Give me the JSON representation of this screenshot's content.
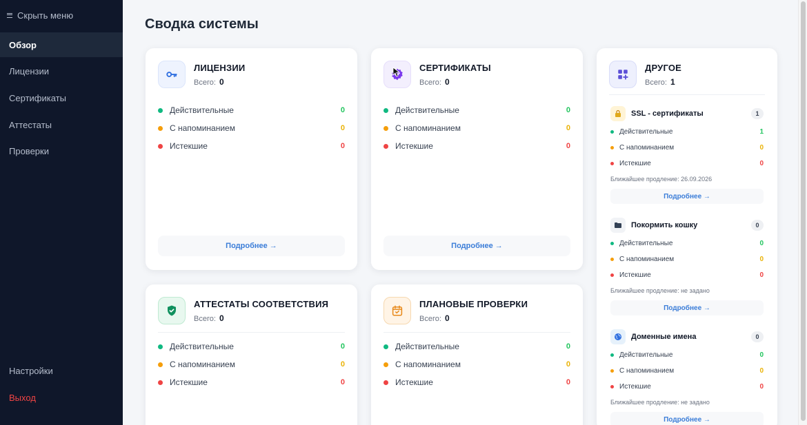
{
  "sidebar": {
    "collapse_label": "Скрыть меню",
    "items": [
      {
        "label": "Обзор"
      },
      {
        "label": "Лицензии"
      },
      {
        "label": "Сертификаты"
      },
      {
        "label": "Аттестаты"
      },
      {
        "label": "Проверки"
      }
    ],
    "settings": "Настройки",
    "logout": "Выход"
  },
  "page_title": "Сводка системы",
  "common": {
    "total_label": "Всего:",
    "valid": "Действительные",
    "reminder": "С напоминанием",
    "expired": "Истекшие",
    "more": "Подробнее →"
  },
  "cards": {
    "licenses": {
      "title": "ЛИЦЕНЗИИ",
      "total": "0",
      "valid": "0",
      "reminder": "0",
      "expired": "0",
      "icon": "key-icon"
    },
    "certificates": {
      "title": "СЕРТИФИКАТЫ",
      "total": "0",
      "valid": "0",
      "reminder": "0",
      "expired": "0",
      "icon": "verified-badge-icon"
    },
    "other": {
      "title": "ДРУГОЕ",
      "total": "1",
      "icon": "grid-plus-icon"
    },
    "attestations": {
      "title": "АТТЕСТАТЫ СООТВЕТСТВИЯ",
      "total": "0",
      "valid": "0",
      "reminder": "0",
      "expired": "0",
      "icon": "shield-check-icon"
    },
    "inspections": {
      "title": "ПЛАНОВЫЕ ПРОВЕРКИ",
      "total": "0",
      "valid": "0",
      "reminder": "0",
      "expired": "0",
      "icon": "calendar-check-icon"
    }
  },
  "other_sections": {
    "ssl": {
      "title": "SSL - сертификаты",
      "count": "1",
      "valid": "1",
      "reminder": "0",
      "expired": "0",
      "renewal": "Ближайшее продление: 26.09.2026",
      "icon": "lock-icon"
    },
    "cat": {
      "title": "Покормить кошку",
      "count": "0",
      "valid": "0",
      "reminder": "0",
      "expired": "0",
      "renewal": "Ближайшее продление: не задано",
      "icon": "folder-icon"
    },
    "domains": {
      "title": "Доменные имена",
      "count": "0",
      "valid": "0",
      "reminder": "0",
      "expired": "0",
      "renewal": "Ближайшее продление: не задано",
      "icon": "globe-icon"
    }
  },
  "colors": {
    "sidebar_bg": "#0f172a",
    "active_item_bg": "#1e293b",
    "valid": "#10b981",
    "reminder": "#f59e0b",
    "expired": "#ef4444",
    "link": "#3b7dd8"
  }
}
